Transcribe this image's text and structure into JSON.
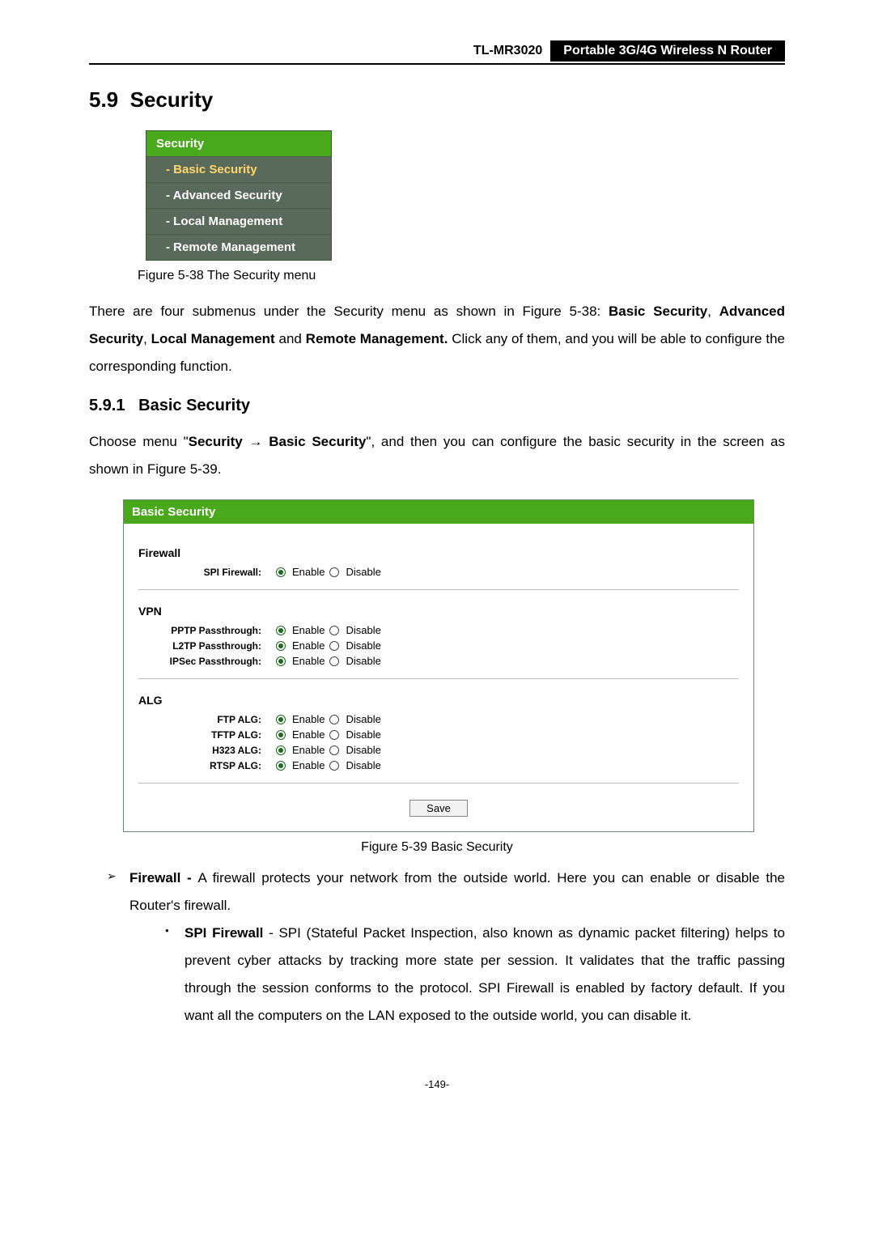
{
  "header": {
    "model": "TL-MR3020",
    "description": "Portable 3G/4G Wireless N Router"
  },
  "section": {
    "number": "5.9",
    "title": "Security"
  },
  "menu": {
    "header": "Security",
    "items": [
      {
        "label": "- Basic Security",
        "active": true
      },
      {
        "label": "- Advanced Security",
        "active": false
      },
      {
        "label": "- Local Management",
        "active": false
      },
      {
        "label": "- Remote Management",
        "active": false
      }
    ]
  },
  "fig38_caption": "Figure 5-38    The Security menu",
  "para1_pre": "There are four submenus under the Security menu as shown in Figure 5-38: ",
  "para1_b1": "Basic Security",
  "para1_mid1": ", ",
  "para1_b2": "Advanced Security",
  "para1_mid2": ", ",
  "para1_b3": "Local Management",
  "para1_mid3": " and ",
  "para1_b4": "Remote Management.",
  "para1_post": " Click any of them, and you will be able to configure the corresponding function.",
  "subsection": {
    "number": "5.9.1",
    "title": "Basic Security"
  },
  "para2_pre": "Choose menu \"",
  "para2_b1": "Security",
  "para2_arrow": "  →  ",
  "para2_b2": "Basic Security",
  "para2_post": "\", and then you can configure the basic security in the screen as shown in Figure 5-39.",
  "panel": {
    "title": "Basic Security",
    "groups": [
      {
        "name": "Firewall",
        "rows": [
          {
            "label": "SPI Firewall:",
            "enable": "Enable",
            "disable": "Disable",
            "selected": "enable"
          }
        ]
      },
      {
        "name": "VPN",
        "rows": [
          {
            "label": "PPTP Passthrough:",
            "enable": "Enable",
            "disable": "Disable",
            "selected": "enable"
          },
          {
            "label": "L2TP Passthrough:",
            "enable": "Enable",
            "disable": "Disable",
            "selected": "enable"
          },
          {
            "label": "IPSec Passthrough:",
            "enable": "Enable",
            "disable": "Disable",
            "selected": "enable"
          }
        ]
      },
      {
        "name": "ALG",
        "rows": [
          {
            "label": "FTP ALG:",
            "enable": "Enable",
            "disable": "Disable",
            "selected": "enable"
          },
          {
            "label": "TFTP ALG:",
            "enable": "Enable",
            "disable": "Disable",
            "selected": "enable"
          },
          {
            "label": "H323 ALG:",
            "enable": "Enable",
            "disable": "Disable",
            "selected": "enable"
          },
          {
            "label": "RTSP ALG:",
            "enable": "Enable",
            "disable": "Disable",
            "selected": "enable"
          }
        ]
      }
    ],
    "save": "Save"
  },
  "fig39_caption": "Figure 5-39    Basic Security",
  "bullets": {
    "firewall_b": "Firewall - ",
    "firewall_text": "A firewall protects your network from the outside world. Here you can enable or disable the Router's firewall.",
    "spi_b": "SPI Firewall",
    "spi_text": " - SPI (Stateful Packet Inspection, also known as dynamic packet filtering) helps to prevent cyber attacks by tracking more state per session. It validates that the traffic passing through the session conforms to the protocol. SPI Firewall is enabled by factory default. If you want all the computers on the LAN exposed to the outside world, you can disable it."
  },
  "page_number": "-149-"
}
